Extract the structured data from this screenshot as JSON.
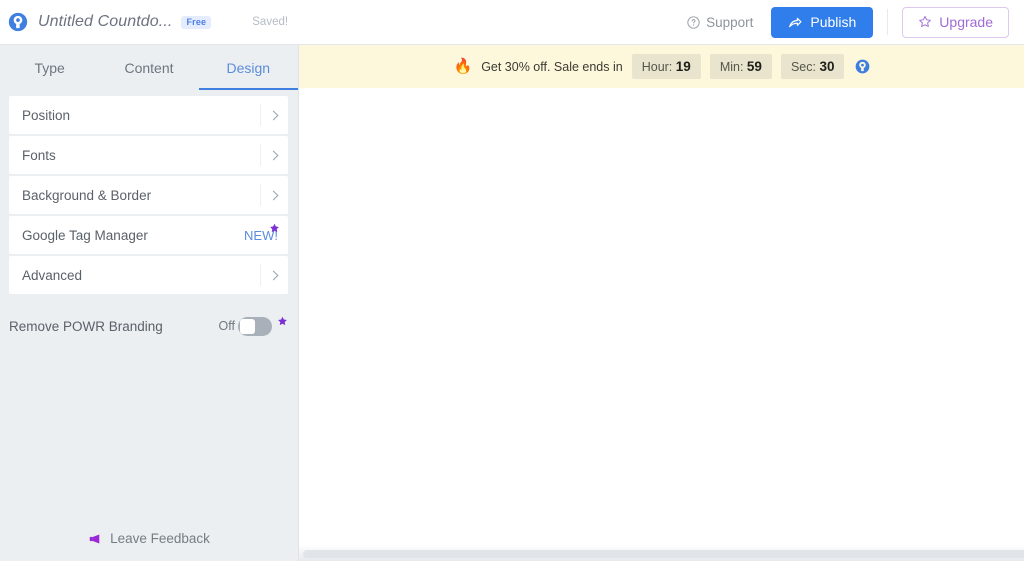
{
  "header": {
    "logo_icon": "powr-logo-icon",
    "title": "Untitled Countdo...",
    "plan_badge": "Free",
    "save_status": "Saved!",
    "support_label": "Support",
    "support_icon": "question-circle-icon",
    "publish_label": "Publish",
    "publish_icon": "share-arrow-icon",
    "upgrade_label": "Upgrade",
    "upgrade_icon": "star-outline-icon",
    "colors": {
      "publish_bg": "#2f7eec",
      "upgrade_text": "#a06cd5",
      "upgrade_border": "#ddc9ef",
      "badge_bg": "#e4ecfd",
      "badge_text": "#4a7fe8"
    }
  },
  "sidebar": {
    "tabs": [
      {
        "label": "Type",
        "active": false
      },
      {
        "label": "Content",
        "active": false
      },
      {
        "label": "Design",
        "active": true
      }
    ],
    "active_tab_color": "#3f7fe0",
    "panels": [
      {
        "label": "Position",
        "chevron_icon": "chevron-right-icon"
      },
      {
        "label": "Fonts",
        "chevron_icon": "chevron-right-icon"
      },
      {
        "label": "Background & Border",
        "chevron_icon": "chevron-right-icon"
      },
      {
        "label": "Google Tag Manager",
        "flag": "NEW!",
        "badge_icon": "premium-star-icon"
      },
      {
        "label": "Advanced",
        "chevron_icon": "chevron-right-icon"
      }
    ],
    "branding": {
      "label": "Remove POWR Branding",
      "toggle_state": "Off",
      "toggle_on": false,
      "badge_icon": "premium-star-icon"
    },
    "feedback": {
      "label": "Leave Feedback",
      "icon": "megaphone-icon",
      "color": "#9b28d6"
    }
  },
  "preview": {
    "countdown": {
      "fire_icon": "fire-emoji",
      "message": "Get 30% off. Sale ends in",
      "units": [
        {
          "label": "Hour:",
          "value": "19"
        },
        {
          "label": "Min:",
          "value": "59"
        },
        {
          "label": "Sec:",
          "value": "30"
        }
      ],
      "branding_icon": "powr-logo-icon",
      "background": "#fdf8dc",
      "unit_background": "#e8e4cd"
    }
  }
}
